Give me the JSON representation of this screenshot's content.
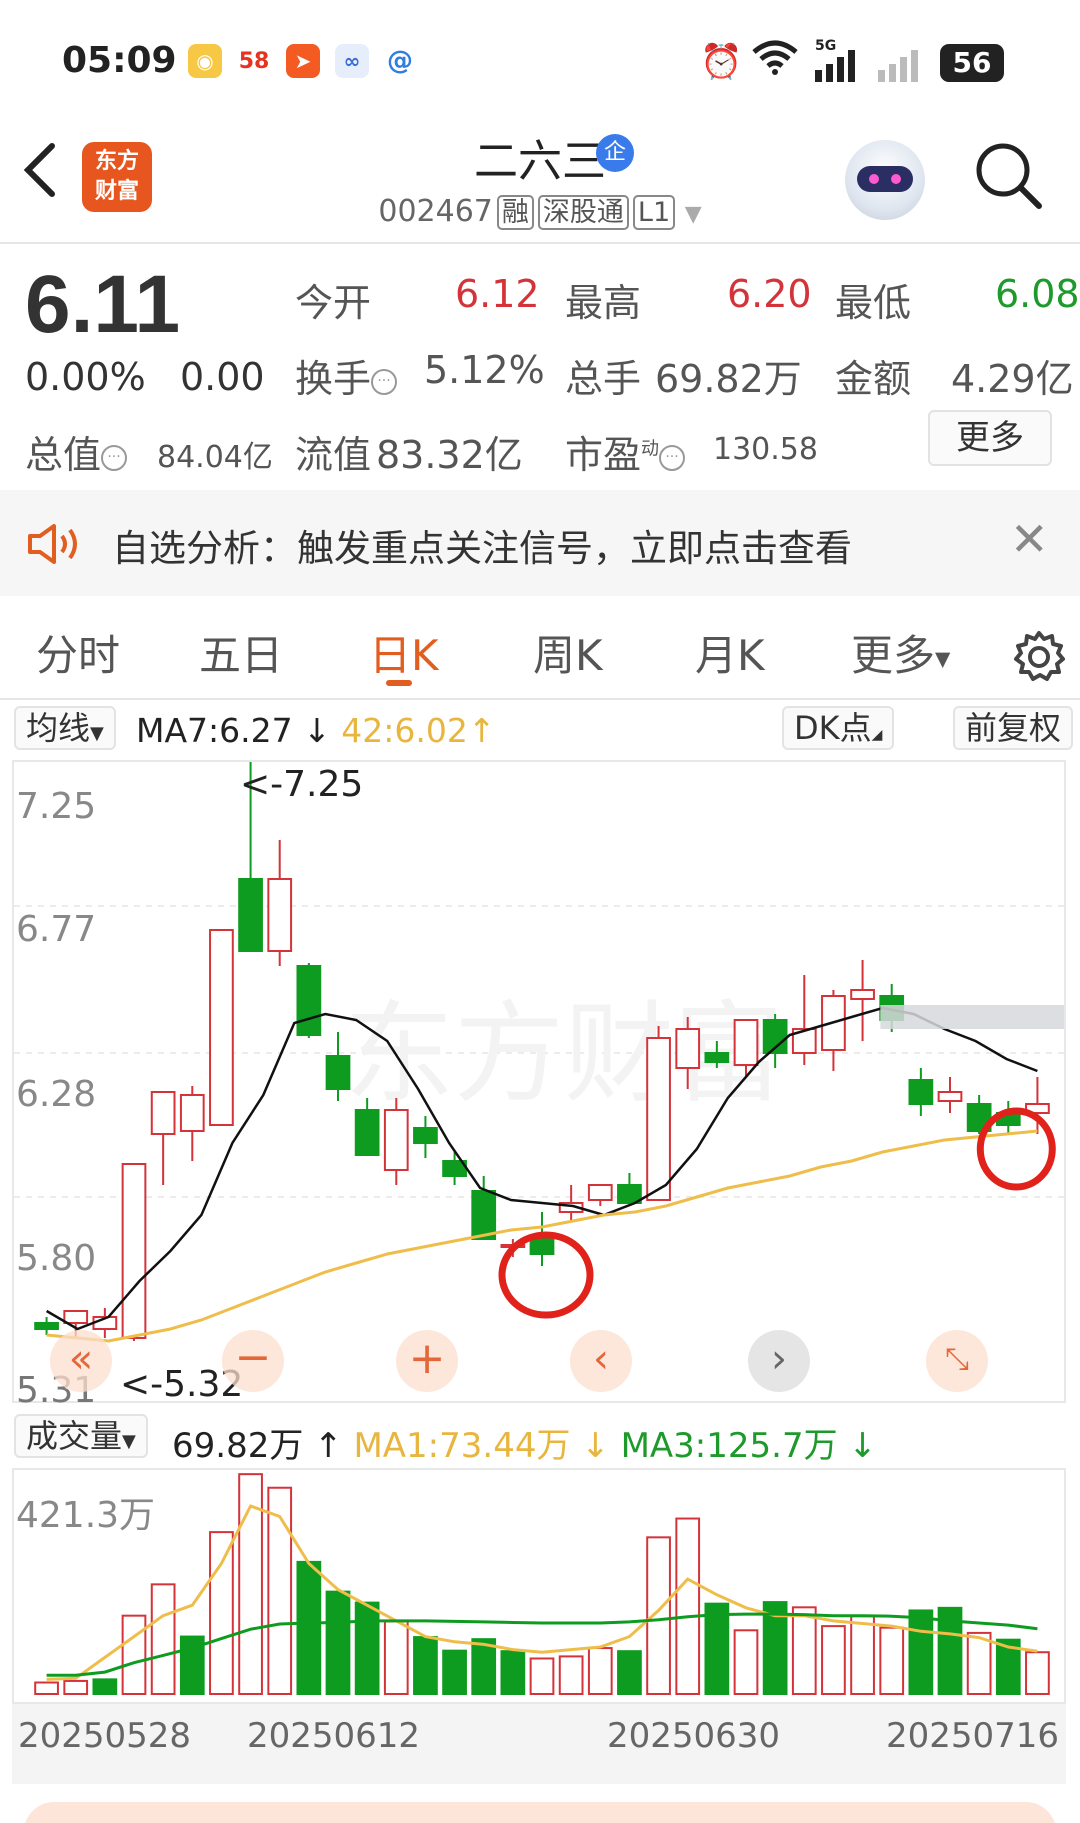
{
  "status_bar": {
    "time": "05:09",
    "network": "5G",
    "battery": "56"
  },
  "header": {
    "logo_text": "东方财富",
    "stock_name": "二六三",
    "badge": "企",
    "code": "002467",
    "tags": [
      "融",
      "深股通",
      "L1"
    ]
  },
  "quote": {
    "price": "6.11",
    "change_pct": "0.00%",
    "change_val": "0.00",
    "open_label": "今开",
    "open": "6.12",
    "high_label": "最高",
    "high": "6.20",
    "low_label": "最低",
    "low": "6.08",
    "turnover_label": "换手",
    "turnover": "5.12%",
    "volume_label": "总手",
    "volume": "69.82万",
    "amount_label": "金额",
    "amount": "4.29亿",
    "mktcap_label": "总值",
    "mktcap": "84.04亿",
    "float_label": "流值",
    "float_val": "83.32亿",
    "pe_label": "市盈",
    "pe_sup": "动",
    "pe": "130.58",
    "more": "更多"
  },
  "notice": {
    "text": "自选分析：触发重点关注信号，立即点击查看"
  },
  "tabs": [
    {
      "label": "分时"
    },
    {
      "label": "五日"
    },
    {
      "label": "日K"
    },
    {
      "label": "周K"
    },
    {
      "label": "月K"
    },
    {
      "label": "更多"
    }
  ],
  "active_tab": "日K",
  "chart_controls": {
    "ma_select": "均线",
    "ma7": "MA7:6.27",
    "ma42": "42:6.02",
    "dk": "DK点",
    "adjust": "前复权",
    "vol_select": "成交量",
    "vol_val": "69.82万",
    "vol_ma1": "MA1:73.44万",
    "vol_ma3": "MA3:125.7万"
  },
  "colors": {
    "up": "#d4333a",
    "down": "#0e9c20",
    "ma_short": "#111111",
    "ma_long": "#efbd4a",
    "accent": "#e25d20"
  },
  "chart_data": [
    {
      "type": "candlestick",
      "ylim": [
        5.32,
        7.25
      ],
      "y_ticks": [
        "7.25",
        "6.77",
        "6.28",
        "5.80",
        "5.31"
      ],
      "annotations": [
        "<-7.25",
        "<-5.32"
      ],
      "x_ticks": [
        "20250528",
        "20250612",
        "20250630",
        "20250716"
      ],
      "series": [
        {
          "name": "MA7",
          "values": [
            5.42,
            5.36,
            5.4,
            5.52,
            5.62,
            5.74,
            5.98,
            6.14,
            6.38,
            6.41,
            6.39,
            6.32,
            6.16,
            5.98,
            5.83,
            5.79,
            5.78,
            5.77,
            5.74,
            5.78,
            5.84,
            5.96,
            6.13,
            6.25,
            6.34,
            6.37,
            6.4,
            6.43,
            6.41,
            6.36,
            6.32,
            6.26,
            6.22
          ]
        },
        {
          "name": "42",
          "values": [
            5.34,
            5.33,
            5.32,
            5.34,
            5.36,
            5.39,
            5.43,
            5.47,
            5.51,
            5.55,
            5.58,
            5.61,
            5.63,
            5.65,
            5.67,
            5.69,
            5.7,
            5.72,
            5.74,
            5.75,
            5.77,
            5.8,
            5.83,
            5.85,
            5.87,
            5.9,
            5.92,
            5.95,
            5.97,
            5.99,
            6.0,
            6.01,
            6.02
          ]
        }
      ],
      "candles": [
        {
          "o": 5.38,
          "h": 5.4,
          "l": 5.34,
          "c": 5.36
        },
        {
          "o": 5.38,
          "h": 5.41,
          "l": 5.33,
          "c": 5.42
        },
        {
          "o": 5.36,
          "h": 5.43,
          "l": 5.33,
          "c": 5.4
        },
        {
          "o": 5.33,
          "h": 5.91,
          "l": 5.32,
          "c": 5.91
        },
        {
          "o": 6.01,
          "h": 6.13,
          "l": 5.84,
          "c": 6.15
        },
        {
          "o": 6.02,
          "h": 6.17,
          "l": 5.92,
          "c": 6.14
        },
        {
          "o": 6.04,
          "h": 6.69,
          "l": 6.04,
          "c": 6.69
        },
        {
          "o": 6.86,
          "h": 7.25,
          "l": 6.66,
          "c": 6.62
        },
        {
          "o": 6.62,
          "h": 6.99,
          "l": 6.57,
          "c": 6.86
        },
        {
          "o": 6.57,
          "h": 6.58,
          "l": 6.33,
          "c": 6.34
        },
        {
          "o": 6.27,
          "h": 6.35,
          "l": 6.12,
          "c": 6.16
        },
        {
          "o": 6.09,
          "h": 6.13,
          "l": 5.94,
          "c": 5.94
        },
        {
          "o": 5.89,
          "h": 6.13,
          "l": 5.84,
          "c": 6.09
        },
        {
          "o": 6.03,
          "h": 6.07,
          "l": 5.93,
          "c": 5.98
        },
        {
          "o": 5.92,
          "h": 5.95,
          "l": 5.84,
          "c": 5.87
        },
        {
          "o": 5.82,
          "h": 5.87,
          "l": 5.67,
          "c": 5.66
        },
        {
          "o": 5.64,
          "h": 5.66,
          "l": 5.6,
          "c": 5.64
        },
        {
          "o": 5.67,
          "h": 5.75,
          "l": 5.57,
          "c": 5.61
        },
        {
          "o": 5.75,
          "h": 5.84,
          "l": 5.72,
          "c": 5.78
        },
        {
          "o": 5.79,
          "h": 5.84,
          "l": 5.77,
          "c": 5.84
        },
        {
          "o": 5.84,
          "h": 5.88,
          "l": 5.77,
          "c": 5.78
        },
        {
          "o": 5.79,
          "h": 6.37,
          "l": 5.79,
          "c": 6.33
        },
        {
          "o": 6.23,
          "h": 6.4,
          "l": 6.16,
          "c": 6.36
        },
        {
          "o": 6.28,
          "h": 6.32,
          "l": 6.23,
          "c": 6.25
        },
        {
          "o": 6.24,
          "h": 6.38,
          "l": 6.2,
          "c": 6.39
        },
        {
          "o": 6.39,
          "h": 6.41,
          "l": 6.23,
          "c": 6.28
        },
        {
          "o": 6.28,
          "h": 6.54,
          "l": 6.24,
          "c": 6.36
        },
        {
          "o": 6.29,
          "h": 6.49,
          "l": 6.22,
          "c": 6.47
        },
        {
          "o": 6.46,
          "h": 6.59,
          "l": 6.32,
          "c": 6.49
        },
        {
          "o": 6.47,
          "h": 6.51,
          "l": 6.35,
          "c": 6.39
        },
        {
          "o": 6.19,
          "h": 6.23,
          "l": 6.07,
          "c": 6.11
        },
        {
          "o": 6.12,
          "h": 6.2,
          "l": 6.08,
          "c": 6.15
        },
        {
          "o": 6.11,
          "h": 6.14,
          "l": 6.01,
          "c": 6.02
        },
        {
          "o": 6.08,
          "h": 6.12,
          "l": 6.01,
          "c": 6.04
        },
        {
          "o": 6.08,
          "h": 6.2,
          "l": 6.01,
          "c": 6.11
        }
      ]
    },
    {
      "type": "bar",
      "ylim": [
        0,
        421.3
      ],
      "y_ticks": [
        "421.3万"
      ],
      "series": [
        {
          "name": "volume",
          "values": [
            22,
            25,
            28,
            150,
            210,
            110,
            310,
            421,
            395,
            253,
            196,
            175,
            139,
            109,
            83,
            105,
            82,
            68,
            72,
            88,
            82,
            300,
            336,
            173,
            122,
            176,
            166,
            130,
            149,
            127,
            160,
            165,
            117,
            104,
            80
          ],
          "up": [
            true,
            true,
            false,
            true,
            true,
            false,
            true,
            true,
            true,
            false,
            false,
            false,
            true,
            false,
            false,
            false,
            false,
            true,
            true,
            true,
            false,
            true,
            true,
            false,
            true,
            false,
            true,
            true,
            true,
            true,
            false,
            false,
            true,
            false,
            true
          ]
        },
        {
          "name": "MA1",
          "values": [
            28,
            30,
            70,
            110,
            150,
            170,
            250,
            360,
            340,
            250,
            200,
            170,
            140,
            110,
            100,
            95,
            85,
            80,
            85,
            90,
            110,
            160,
            220,
            190,
            165,
            150,
            150,
            140,
            135,
            130,
            120,
            115,
            108,
            90,
            82
          ]
        },
        {
          "name": "MA3",
          "values": [
            36,
            36,
            42,
            60,
            74,
            88,
            106,
            124,
            134,
            136,
            137,
            140,
            140,
            140,
            139,
            138,
            137,
            136,
            136,
            136,
            138,
            142,
            148,
            152,
            153,
            153,
            152,
            150,
            150,
            149,
            146,
            140,
            136,
            132,
            125
          ]
        }
      ]
    }
  ]
}
